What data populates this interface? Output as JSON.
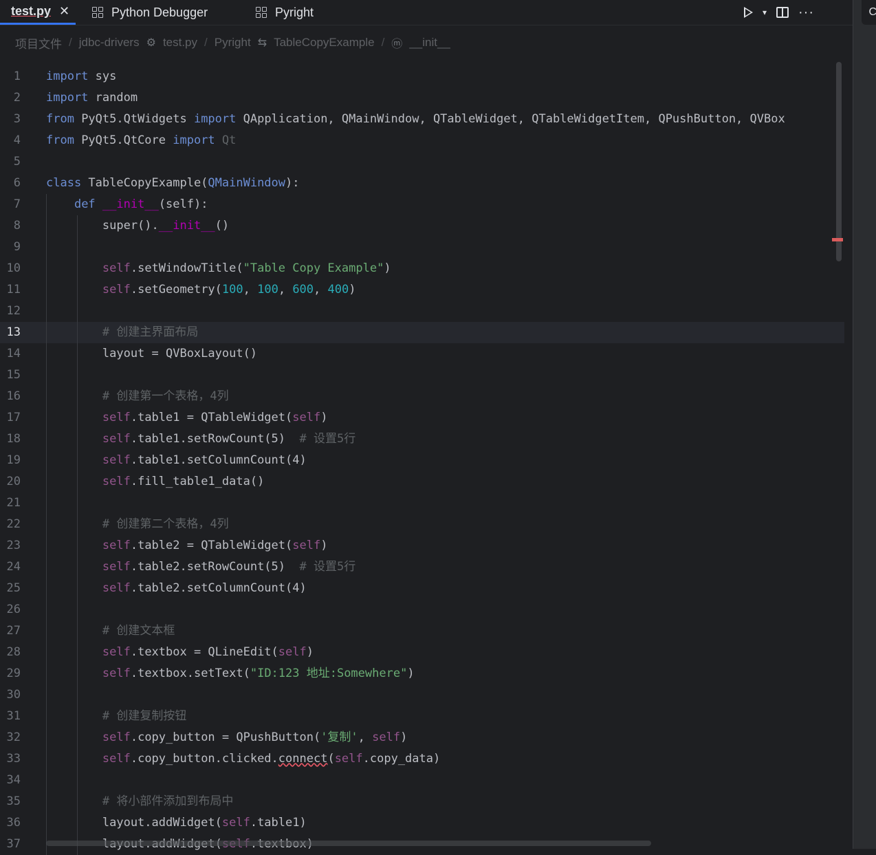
{
  "tabs": [
    {
      "label": "test.py",
      "close": "✕"
    },
    {
      "label": "Python Debugger"
    },
    {
      "label": "Pyright"
    }
  ],
  "toolbar": {
    "run": "▶",
    "dropdown": "▾",
    "split": "split",
    "more": "···"
  },
  "side_strip": {
    "label": "C"
  },
  "breadcrumb": [
    "项目文件",
    "jdbc-drivers",
    "test.py",
    "Pyright",
    "TableCopyExample",
    "__init__"
  ],
  "current_line": 13,
  "lines": [
    {
      "n": "1",
      "tokens": [
        [
          "kw2",
          "import"
        ],
        [
          "plain",
          " sys"
        ]
      ]
    },
    {
      "n": "2",
      "tokens": [
        [
          "kw2",
          "import"
        ],
        [
          "plain",
          " random"
        ]
      ]
    },
    {
      "n": "3",
      "tokens": [
        [
          "kw2",
          "from"
        ],
        [
          "plain",
          " PyQt5.QtWidgets "
        ],
        [
          "kw2",
          "import"
        ],
        [
          "plain",
          " QApplication, QMainWindow, QTableWidget, QTableWidgetItem, QPushButton, QVBox"
        ]
      ]
    },
    {
      "n": "4",
      "tokens": [
        [
          "kw2",
          "from"
        ],
        [
          "plain",
          " PyQt5.QtCore "
        ],
        [
          "kw2",
          "import"
        ],
        [
          "cmt",
          " Qt"
        ]
      ]
    },
    {
      "n": "5",
      "tokens": []
    },
    {
      "n": "6",
      "tokens": [
        [
          "kw2",
          "class"
        ],
        [
          "plain",
          " TableCopyExample("
        ],
        [
          "kw2",
          "QMainWindow"
        ],
        [
          "plain",
          "):"
        ]
      ]
    },
    {
      "n": "7",
      "tokens": [
        [
          "plain",
          "    "
        ],
        [
          "kw2",
          "def"
        ],
        [
          "plain",
          " "
        ],
        [
          "dunder",
          "__init__"
        ],
        [
          "plain",
          "(self):"
        ]
      ]
    },
    {
      "n": "8",
      "tokens": [
        [
          "plain",
          "        super()."
        ],
        [
          "dunder",
          "__init__"
        ],
        [
          "plain",
          "()"
        ]
      ]
    },
    {
      "n": "9",
      "tokens": []
    },
    {
      "n": "10",
      "tokens": [
        [
          "plain",
          "        "
        ],
        [
          "self",
          "self"
        ],
        [
          "plain",
          ".setWindowTitle("
        ],
        [
          "str",
          "\"Table Copy Example\""
        ],
        [
          "plain",
          ")"
        ]
      ]
    },
    {
      "n": "11",
      "tokens": [
        [
          "plain",
          "        "
        ],
        [
          "self",
          "self"
        ],
        [
          "plain",
          ".setGeometry("
        ],
        [
          "num-lit",
          "100"
        ],
        [
          "plain",
          ", "
        ],
        [
          "num-lit",
          "100"
        ],
        [
          "plain",
          ", "
        ],
        [
          "num-lit",
          "600"
        ],
        [
          "plain",
          ", "
        ],
        [
          "num-lit",
          "400"
        ],
        [
          "plain",
          ")"
        ]
      ]
    },
    {
      "n": "12",
      "tokens": []
    },
    {
      "n": "13",
      "tokens": [
        [
          "plain",
          "        "
        ],
        [
          "cmt",
          "# 创建主界面布局"
        ]
      ]
    },
    {
      "n": "14",
      "tokens": [
        [
          "plain",
          "        layout = QVBoxLayout()"
        ]
      ]
    },
    {
      "n": "15",
      "tokens": []
    },
    {
      "n": "16",
      "tokens": [
        [
          "plain",
          "        "
        ],
        [
          "cmt",
          "# 创建第一个表格，4列"
        ]
      ]
    },
    {
      "n": "17",
      "tokens": [
        [
          "plain",
          "        "
        ],
        [
          "self",
          "self"
        ],
        [
          "plain",
          ".table1 = QTableWidget("
        ],
        [
          "self",
          "self"
        ],
        [
          "plain",
          ")"
        ]
      ]
    },
    {
      "n": "18",
      "tokens": [
        [
          "plain",
          "        "
        ],
        [
          "self",
          "self"
        ],
        [
          "plain",
          ".table1.setRowCount(5)  "
        ],
        [
          "cmt",
          "# 设置5行"
        ]
      ]
    },
    {
      "n": "19",
      "tokens": [
        [
          "plain",
          "        "
        ],
        [
          "self",
          "self"
        ],
        [
          "plain",
          ".table1.setColumnCount(4)"
        ]
      ]
    },
    {
      "n": "20",
      "tokens": [
        [
          "plain",
          "        "
        ],
        [
          "self",
          "self"
        ],
        [
          "plain",
          ".fill_table1_data()"
        ]
      ]
    },
    {
      "n": "21",
      "tokens": []
    },
    {
      "n": "22",
      "tokens": [
        [
          "plain",
          "        "
        ],
        [
          "cmt",
          "# 创建第二个表格，4列"
        ]
      ]
    },
    {
      "n": "23",
      "tokens": [
        [
          "plain",
          "        "
        ],
        [
          "self",
          "self"
        ],
        [
          "plain",
          ".table2 = QTableWidget("
        ],
        [
          "self",
          "self"
        ],
        [
          "plain",
          ")"
        ]
      ]
    },
    {
      "n": "24",
      "tokens": [
        [
          "plain",
          "        "
        ],
        [
          "self",
          "self"
        ],
        [
          "plain",
          ".table2.setRowCount(5)  "
        ],
        [
          "cmt",
          "# 设置5行"
        ]
      ]
    },
    {
      "n": "25",
      "tokens": [
        [
          "plain",
          "        "
        ],
        [
          "self",
          "self"
        ],
        [
          "plain",
          ".table2.setColumnCount(4)"
        ]
      ]
    },
    {
      "n": "26",
      "tokens": []
    },
    {
      "n": "27",
      "tokens": [
        [
          "plain",
          "        "
        ],
        [
          "cmt",
          "# 创建文本框"
        ]
      ]
    },
    {
      "n": "28",
      "tokens": [
        [
          "plain",
          "        "
        ],
        [
          "self",
          "self"
        ],
        [
          "plain",
          ".textbox = QLineEdit("
        ],
        [
          "self",
          "self"
        ],
        [
          "plain",
          ")"
        ]
      ]
    },
    {
      "n": "29",
      "tokens": [
        [
          "plain",
          "        "
        ],
        [
          "self",
          "self"
        ],
        [
          "plain",
          ".textbox.setText("
        ],
        [
          "str",
          "\"ID:123 地址:Somewhere\""
        ],
        [
          "plain",
          ")"
        ]
      ]
    },
    {
      "n": "30",
      "tokens": []
    },
    {
      "n": "31",
      "tokens": [
        [
          "plain",
          "        "
        ],
        [
          "cmt",
          "# 创建复制按钮"
        ]
      ]
    },
    {
      "n": "32",
      "tokens": [
        [
          "plain",
          "        "
        ],
        [
          "self",
          "self"
        ],
        [
          "plain",
          ".copy_button = QPushButton("
        ],
        [
          "str",
          "'复制'"
        ],
        [
          "plain",
          ", "
        ],
        [
          "self",
          "self"
        ],
        [
          "plain",
          ")"
        ]
      ]
    },
    {
      "n": "33",
      "tokens": [
        [
          "plain",
          "        "
        ],
        [
          "self",
          "self"
        ],
        [
          "plain",
          ".copy_button.clicked."
        ],
        [
          "squiggle",
          "connect"
        ],
        [
          "plain",
          "("
        ],
        [
          "self",
          "self"
        ],
        [
          "plain",
          ".copy_data)"
        ]
      ]
    },
    {
      "n": "34",
      "tokens": []
    },
    {
      "n": "35",
      "tokens": [
        [
          "plain",
          "        "
        ],
        [
          "cmt",
          "# 将小部件添加到布局中"
        ]
      ]
    },
    {
      "n": "36",
      "tokens": [
        [
          "plain",
          "        layout.addWidget("
        ],
        [
          "self",
          "self"
        ],
        [
          "plain",
          ".table1)"
        ]
      ]
    },
    {
      "n": "37",
      "tokens": [
        [
          "plain",
          "        layout.addWidget("
        ],
        [
          "self",
          "self"
        ],
        [
          "plain",
          ".textbox)"
        ]
      ]
    }
  ]
}
